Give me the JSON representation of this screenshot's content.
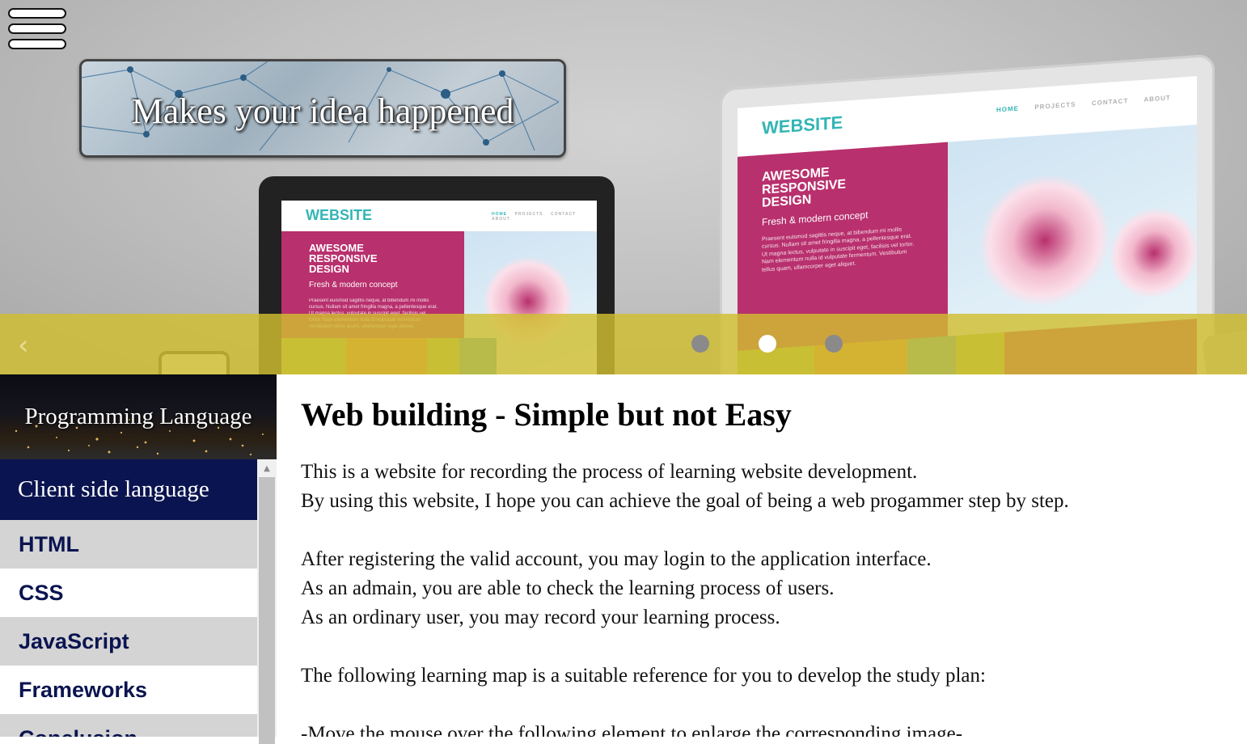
{
  "hero": {
    "tagline": "Makes your idea happened",
    "mockup": {
      "logo": "WEBSITE",
      "nav": [
        "HOME",
        "PROJECTS",
        "CONTACT",
        "ABOUT"
      ],
      "headline": [
        "AWESOME",
        "RESPONSIVE",
        "DESIGN"
      ],
      "subline": "Fresh & modern concept",
      "body_small": "Praesent euismod sagittis neque, at bibendum mi mollis cursus. Nullam sit amet fringilla magna, a pellentesque erat. Ut magna lectus, vulputate in suscipit eget, facilisis vel tortor. Nam elementum nulla id vulputate fermentum. Vestibulum tellus quam, ullamcorper eget aliquet.",
      "body_big": "Praesent euismod sagittis neque, at bibendum mi mollis cursus. Nullam sit amet fringilla magna, a pellentesque erat. Ut magna lectus, vulputate in suscipit eget, facilisis vel tortor. Nam elementum nulla id vulputate fermentum. Vestibulum tellus quam, ullamcorper eget aliquet."
    },
    "carousel": {
      "prev_glyph": "‹",
      "slide_count": 3,
      "active_index": 1
    },
    "colors": {
      "overlay": "#d1be30",
      "magenta": "#b8306d",
      "teal": "#33b5b5"
    }
  },
  "sidebar": {
    "title": "Programming Language",
    "heading": "Client side language",
    "items": [
      "HTML",
      "CSS",
      "JavaScript",
      "Frameworks",
      "Conclusion"
    ],
    "colors": {
      "heading_bg": "#0a1450",
      "item_text": "#0a1450"
    }
  },
  "main": {
    "title": "Web building - Simple but not Easy",
    "paragraphs": [
      [
        "This is a website for recording the process of learning website development.",
        "By using this website, I hope you can achieve the goal of being a web progammer step by step."
      ],
      [
        "After registering the valid account, you may login to the application interface.",
        "As an admain, you are able to check the learning process of users.",
        "As an ordinary user, you may record your learning process."
      ],
      [
        "The following learning map is a suitable reference for you to develop the study plan:"
      ],
      [
        "-Move the mouse over the following element to enlarge the corresponding image-"
      ]
    ]
  }
}
